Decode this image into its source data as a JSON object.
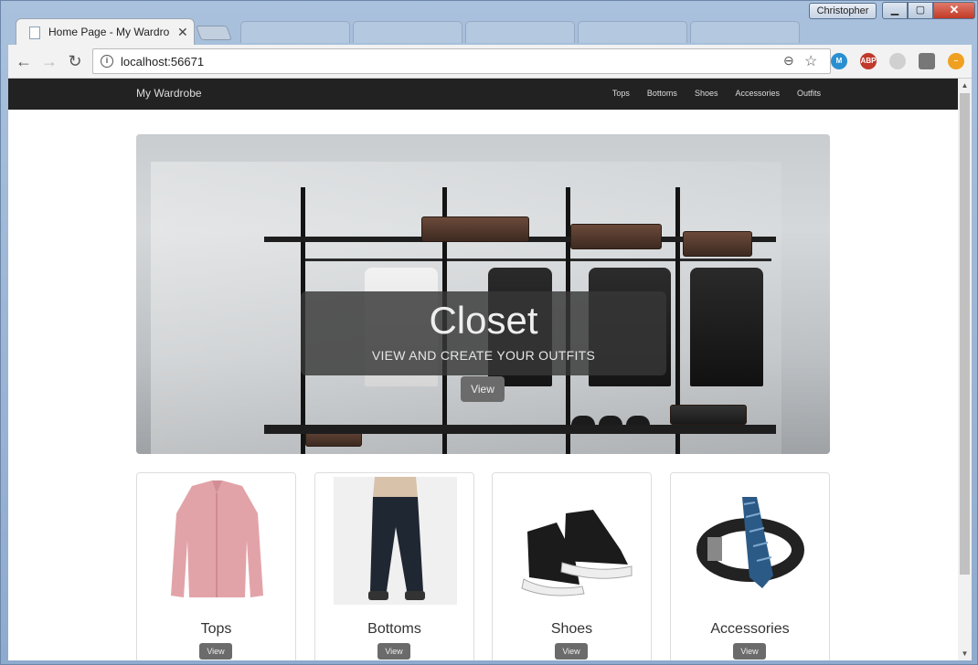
{
  "window": {
    "user": "Christopher",
    "active_tab_title": "Home Page - My Wardrobe",
    "url": "localhost:56671"
  },
  "extensions": [
    {
      "name": "M",
      "color": "#2a8fd0"
    },
    {
      "name": "ABP",
      "color": "#c0392b"
    },
    {
      "name": "",
      "color": "#d0d0d0"
    },
    {
      "name": "",
      "color": "#777777"
    },
    {
      "name": "–",
      "color": "#f0a020"
    }
  ],
  "navbar": {
    "brand": "My Wardrobe",
    "links": [
      "Tops",
      "Bottoms",
      "Shoes",
      "Accessories",
      "Outfits"
    ]
  },
  "hero": {
    "title": "Closet",
    "subtitle": "VIEW AND CREATE YOUR OUTFITS",
    "button": "View"
  },
  "categories": [
    {
      "name": "Tops",
      "button": "View"
    },
    {
      "name": "Bottoms",
      "button": "View"
    },
    {
      "name": "Shoes",
      "button": "View"
    },
    {
      "name": "Accessories",
      "button": "View"
    }
  ]
}
